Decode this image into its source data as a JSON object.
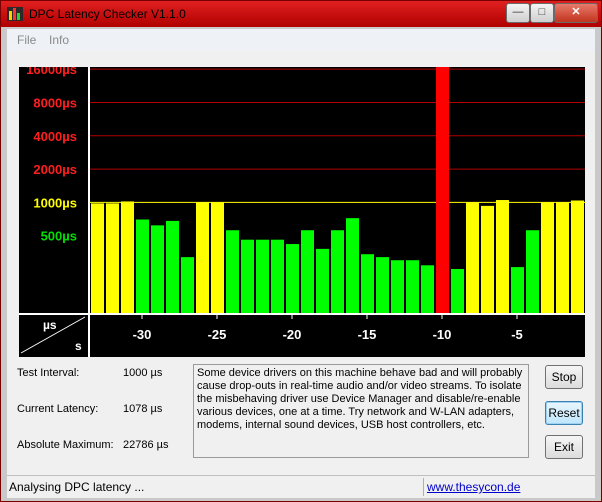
{
  "window": {
    "title": "DPC Latency Checker V1.1.0",
    "icon": "bar-chart-icon",
    "controls": {
      "minimize": "—",
      "maximize": "□",
      "close": "✕"
    }
  },
  "menu": {
    "items": [
      "File",
      "Info"
    ]
  },
  "chart_data": {
    "type": "bar",
    "y_axis": {
      "labels": [
        {
          "text": "16000µs",
          "value": 16000,
          "color": "#ff1e1e"
        },
        {
          "text": "8000µs",
          "value": 8000,
          "color": "#ff1e1e"
        },
        {
          "text": "4000µs",
          "value": 4000,
          "color": "#ff1e1e"
        },
        {
          "text": "2000µs",
          "value": 2000,
          "color": "#ff1e1e"
        },
        {
          "text": "1000µs",
          "value": 1000,
          "color": "#ffff00"
        },
        {
          "text": "500µs",
          "value": 500,
          "color": "#00e000"
        }
      ],
      "scale": "log"
    },
    "x_axis": {
      "unit_top": "µs",
      "unit_bottom": "s",
      "ticks": [
        -30,
        -25,
        -20,
        -15,
        -10,
        -5
      ]
    },
    "x": [
      -33,
      -32,
      -31,
      -30,
      -29,
      -28,
      -27,
      -26,
      -25,
      -24,
      -23,
      -22,
      -21,
      -20,
      -19,
      -18,
      -17,
      -16,
      -15,
      -14,
      -13,
      -12,
      -11,
      -10,
      -9,
      -8,
      -7,
      -6,
      -5,
      -4,
      -3,
      -2,
      -1
    ],
    "values": [
      980,
      980,
      1020,
      700,
      620,
      680,
      320,
      1000,
      1000,
      560,
      460,
      460,
      460,
      420,
      560,
      380,
      560,
      720,
      340,
      320,
      300,
      300,
      270,
      22786,
      250,
      1000,
      930,
      1050,
      260,
      560,
      1000,
      1000,
      1040
    ],
    "colors": {
      "green": "#00ff00",
      "yellow": "#ffff00",
      "red": "#ff0000"
    },
    "background": "#000000",
    "gridline_color": "#b00000",
    "threshold_color": "#ffff00"
  },
  "stats": {
    "test_interval_label": "Test Interval:",
    "test_interval_value": "1000 µs",
    "current_latency_label": "Current Latency:",
    "current_latency_value": "1078 µs",
    "absolute_max_label": "Absolute Maximum:",
    "absolute_max_value": "22786 µs"
  },
  "info_text": "Some device drivers on this machine behave bad and will probably cause drop-outs in real-time audio and/or video streams. To isolate the misbehaving driver use Device Manager and disable/re-enable various devices, one at a time. Try network and W-LAN adapters, modems, internal sound devices, USB host controllers, etc.",
  "buttons": {
    "stop": "Stop",
    "reset": "Reset",
    "exit": "Exit"
  },
  "status": {
    "text": "Analysing DPC latency ...",
    "link": "www.thesycon.de"
  }
}
